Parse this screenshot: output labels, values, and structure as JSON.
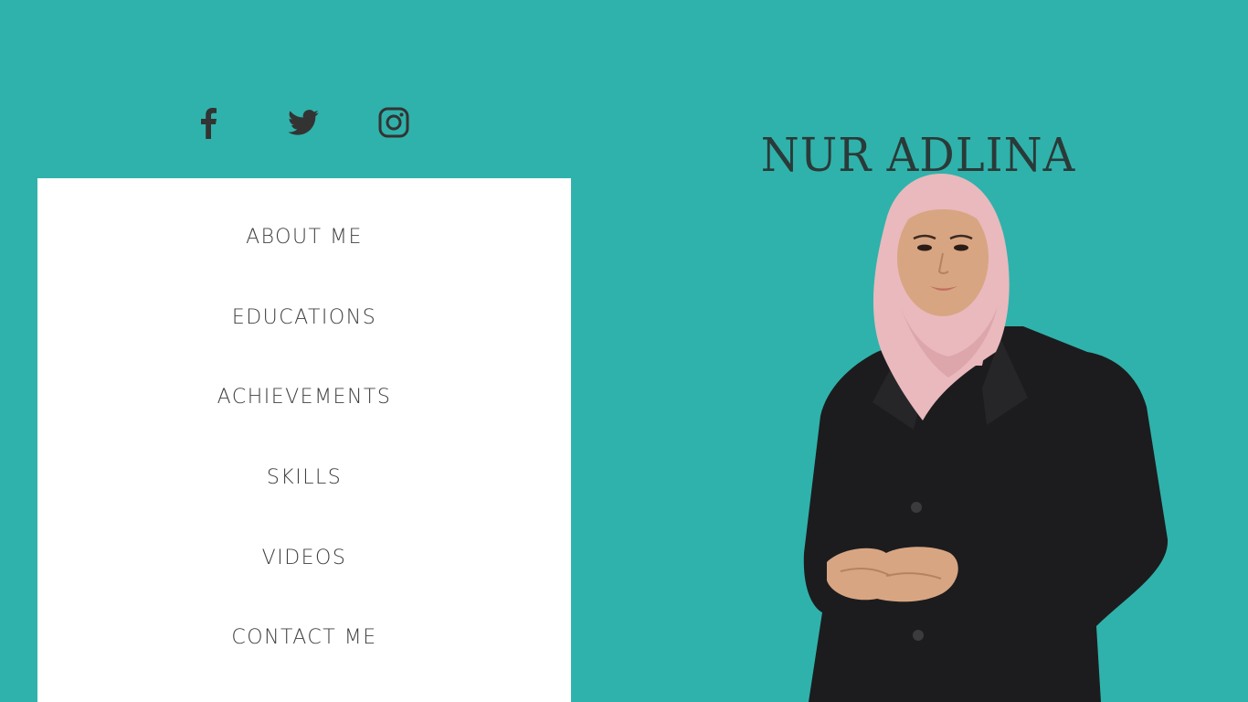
{
  "social": {
    "icons": [
      "facebook-icon",
      "twitter-icon",
      "instagram-icon"
    ]
  },
  "menu": {
    "items": [
      {
        "label": "ABOUT ME"
      },
      {
        "label": "EDUCATIONS"
      },
      {
        "label": "ACHIEVEMENTS"
      },
      {
        "label": "SKILLS"
      },
      {
        "label": "VIDEOS"
      },
      {
        "label": "CONTACT ME"
      }
    ]
  },
  "profile": {
    "name": "NUR ADLINA"
  },
  "colors": {
    "background": "#2fb2ab",
    "panel": "#ffffff",
    "text": "#3f3f3f",
    "jacket": "#1c1c1e",
    "hijab": "#e9b9bd"
  }
}
